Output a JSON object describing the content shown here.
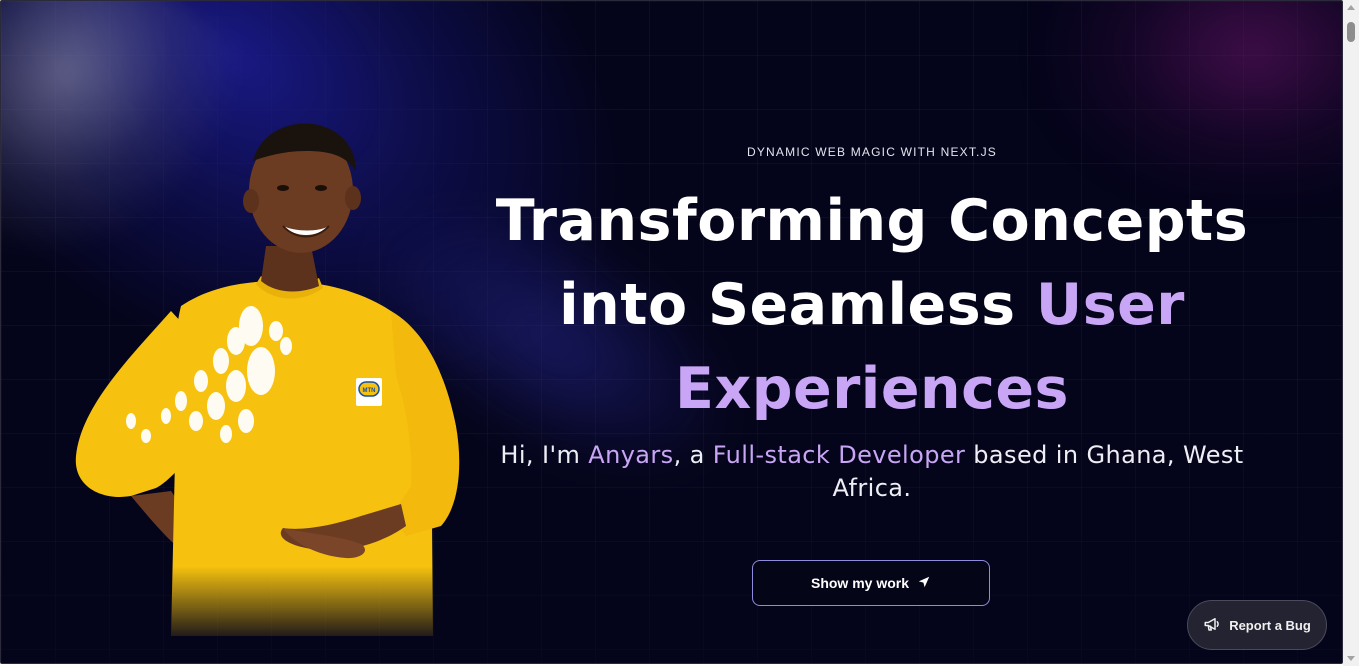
{
  "hero": {
    "eyebrow": "DYNAMIC WEB MAGIC WITH NEXT.JS",
    "headline_part1": "Transforming Concepts into Seamless ",
    "headline_accent": "User Experiences",
    "intro_prefix": "Hi, I'm ",
    "intro_name": "Anyars",
    "intro_middle": ", a ",
    "intro_role": "Full-stack Developer",
    "intro_suffix": " based in Ghana, West Africa."
  },
  "cta": {
    "label": "Show my work",
    "icon": "navigation-arrow-icon"
  },
  "report_bug": {
    "label": "Report a Bug",
    "icon": "megaphone-icon"
  },
  "portrait": {
    "badge_text": "MTN"
  },
  "colors": {
    "background": "#04041a",
    "accent": "#c9a6f5",
    "shirt": "#f6c20f",
    "cta_border": "#8f8bdc"
  }
}
